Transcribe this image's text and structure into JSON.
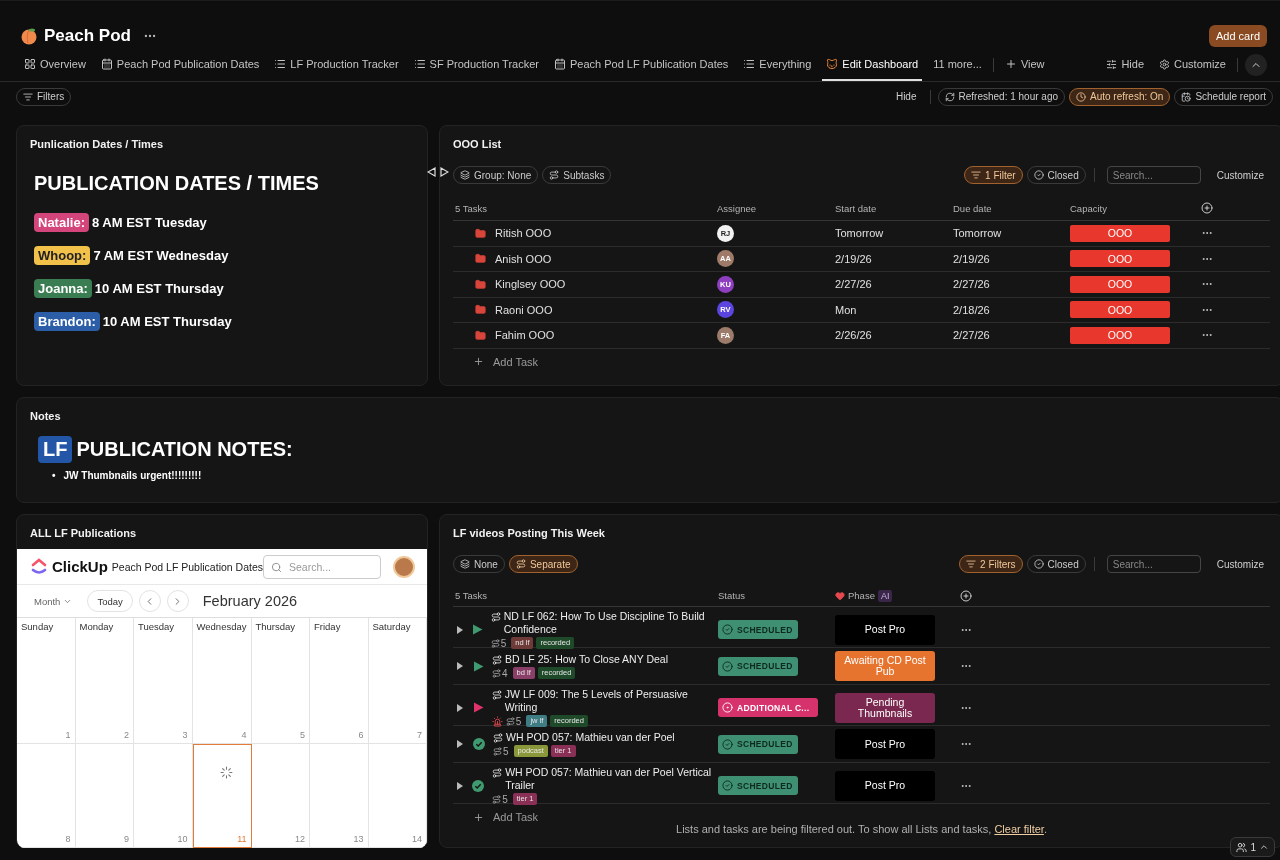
{
  "header": {
    "title": "Peach Pod",
    "add_card": "Add card"
  },
  "tabs": [
    {
      "label": "Overview",
      "kind": "grid",
      "selected": false
    },
    {
      "label": "Peach Pod Publication Dates",
      "kind": "calendar",
      "selected": false
    },
    {
      "label": "LF Production Tracker",
      "kind": "list",
      "selected": false
    },
    {
      "label": "SF Production Tracker",
      "kind": "list",
      "selected": false
    },
    {
      "label": "Peach Pod LF Publication Dates",
      "kind": "calendar",
      "selected": false
    },
    {
      "label": "Everything",
      "kind": "list",
      "selected": false
    },
    {
      "label": "Edit Dashboard",
      "kind": "cat",
      "selected": true
    }
  ],
  "tabs_more": "11 more...",
  "tabs_view": "View",
  "tabs_hide": "Hide",
  "tabs_customize": "Customize",
  "toolbar": {
    "filters": {
      "label": "Filters",
      "kind": "filter",
      "active": false
    },
    "hide": "Hide",
    "pills": [
      {
        "label": "Refreshed: 1 hour ago",
        "kind": "refresh",
        "active": false
      },
      {
        "label": "Auto refresh: On",
        "kind": "clock",
        "active": true
      },
      {
        "label": "Schedule report",
        "kind": "schedule",
        "active": false
      }
    ]
  },
  "publication": {
    "title": "Punlication Dates / Times",
    "heading": "PUBLICATION DATES / TIMES",
    "entries": [
      {
        "name": "Natalie:",
        "color": "#d4457c",
        "text": "8 AM EST Tuesday"
      },
      {
        "name": "Whoop:",
        "color": "#f2c14a",
        "text": "7 AM EST Wednesday"
      },
      {
        "name": "Joanna:",
        "color": "#3b7d52",
        "text": "10 AM EST Thursday"
      },
      {
        "name": "Brandon:",
        "color": "#2c5ea8",
        "text": "10 AM EST Thursday"
      }
    ]
  },
  "ooo": {
    "title": "OOO List",
    "left_pills": [
      {
        "label": "Group: None",
        "kind": "layers",
        "active": false
      },
      {
        "label": "Subtasks",
        "kind": "subtasks",
        "active": false
      }
    ],
    "right_pills": [
      {
        "label": "1 Filter",
        "kind": "filter",
        "active": true
      },
      {
        "label": "Closed",
        "kind": "closed",
        "active": false
      }
    ],
    "search_placeholder": "Search...",
    "customize": "Customize",
    "columns": [
      "5 Tasks",
      "Assignee",
      "Start date",
      "Due date",
      "Capacity"
    ],
    "rows": [
      {
        "name": "Ritish OOO",
        "initials": "RJ",
        "color": "#f2f2f2",
        "start": "Tomorrow",
        "due": "Tomorrow",
        "capacity": "OOO"
      },
      {
        "name": "Anish OOO",
        "initials": "AA",
        "color": "#a07a68",
        "start": "2/19/26",
        "due": "2/19/26",
        "capacity": "OOO"
      },
      {
        "name": "Kinglsey OOO",
        "initials": "KU",
        "color": "#8e3fc0",
        "start": "2/27/26",
        "due": "2/27/26",
        "capacity": "OOO"
      },
      {
        "name": "Raoni OOO",
        "initials": "RV",
        "color": "#5b45e0",
        "start": "Mon",
        "due": "2/18/26",
        "capacity": "OOO"
      },
      {
        "name": "Fahim OOO",
        "initials": "FA",
        "color": "#9c7b6a",
        "start": "2/26/26",
        "due": "2/27/26",
        "capacity": "OOO"
      }
    ],
    "add_task": "Add Task"
  },
  "notes": {
    "title": "Notes",
    "badge": "LF",
    "heading": "PUBLICATION NOTES:",
    "items": [
      {
        "marker": "•",
        "text": "JW Thumbnails urgent!!!!!!!!!"
      }
    ]
  },
  "calendar": {
    "title": "ALL LF Publications",
    "brand": "ClickUp",
    "embed_title": "Peach Pod LF Publication Dates",
    "search_placeholder": "Search...",
    "view": "Month",
    "today": "Today",
    "month": "February 2026",
    "weekdays": [
      "Sunday",
      "Monday",
      "Tuesday",
      "Wednesday",
      "Thursday",
      "Friday",
      "Saturday"
    ],
    "weeks": [
      [
        {
          "day": "1",
          "selected": false
        },
        {
          "day": "2",
          "selected": false
        },
        {
          "day": "3",
          "selected": false
        },
        {
          "day": "4",
          "selected": false
        },
        {
          "day": "5",
          "selected": false
        },
        {
          "day": "6",
          "selected": false
        },
        {
          "day": "7",
          "selected": false
        }
      ],
      [
        {
          "day": "8",
          "selected": false
        },
        {
          "day": "9",
          "selected": false
        },
        {
          "day": "10",
          "selected": false
        },
        {
          "day": "11",
          "selected": true,
          "loading": true
        },
        {
          "day": "12",
          "selected": false
        },
        {
          "day": "13",
          "selected": false
        },
        {
          "day": "14",
          "selected": false
        }
      ]
    ]
  },
  "videos": {
    "title": "LF videos Posting This Week",
    "left_pills": [
      {
        "label": "None",
        "kind": "layers",
        "active": false
      },
      {
        "label": "Separate",
        "kind": "subtasks",
        "active": true
      }
    ],
    "right_pills": [
      {
        "label": "2 Filters",
        "kind": "filter",
        "active": true
      },
      {
        "label": "Closed",
        "kind": "closed",
        "active": false
      }
    ],
    "search_placeholder": "Search...",
    "customize": "Customize",
    "columns": [
      "5 Tasks",
      "Status",
      "Phase"
    ],
    "ai": "AI",
    "tasks": [
      {
        "title": "ND LF 062: How To Use Discipline To Build Confidence",
        "subtasks": "5",
        "state": {
          "kind": "play",
          "color": "#3f9a70"
        },
        "tags": [
          {
            "label": "nd lf",
            "color": "#6e3b38"
          },
          {
            "label": "recorded",
            "color": "#1f4a2a"
          }
        ],
        "status": {
          "label": "SCHEDULED",
          "kind": "check",
          "color": "#3f8f72"
        },
        "phase": {
          "label": "Post Pro",
          "color": "#000000"
        }
      },
      {
        "title": "BD LF 25: How To Close ANY Deal",
        "subtasks": "4",
        "state": {
          "kind": "play",
          "color": "#3f9a70"
        },
        "tags": [
          {
            "label": "bd lf",
            "color": "#8a3f68"
          },
          {
            "label": "recorded",
            "color": "#1f4a2a"
          }
        ],
        "status": {
          "label": "SCHEDULED",
          "kind": "check",
          "color": "#3f8f72"
        },
        "phase": {
          "label": "Awaiting CD Post Pub",
          "color": "#e6742e"
        }
      },
      {
        "title": "JW LF 009: The 5 Levels of Persuasive Writing",
        "alert": true,
        "subtasks": "5",
        "state": {
          "kind": "play",
          "color": "#e0336b"
        },
        "tags": [
          {
            "label": "jw lf",
            "color": "#3f7d85"
          },
          {
            "label": "recorded",
            "color": "#1f4a2a"
          }
        ],
        "status": {
          "label": "ADDITIONAL C...",
          "kind": "ring",
          "color": "#d6336c"
        },
        "phase": {
          "label": "Pending Thumbnails",
          "color": "#7a2850"
        }
      },
      {
        "title": "WH POD 057: Mathieu van der Poel",
        "subtasks": "5",
        "state": {
          "kind": "check",
          "color": "#3f9a70"
        },
        "tags": [
          {
            "label": "podcast",
            "color": "#8a983a"
          },
          {
            "label": "tier 1",
            "color": "#8a2f55"
          }
        ],
        "status": {
          "label": "SCHEDULED",
          "kind": "check",
          "color": "#3f8f72"
        },
        "phase": {
          "label": "Post Pro",
          "color": "#000000"
        }
      },
      {
        "title": "WH POD 057: Mathieu van der Poel Vertical Trailer",
        "subtasks": "5",
        "state": {
          "kind": "check",
          "color": "#3f9a70"
        },
        "tags": [
          {
            "label": "tier 1",
            "color": "#8a2f55"
          }
        ],
        "status": {
          "label": "SCHEDULED",
          "kind": "check",
          "color": "#3f8f72"
        },
        "phase": {
          "label": "Post Pro",
          "color": "#000000"
        }
      }
    ],
    "add_task": "Add Task",
    "footer": {
      "text": "Lists and tasks are being filtered out. To show all Lists and tasks,",
      "link": "Clear filter",
      "end": "."
    }
  },
  "viewers": "1"
}
